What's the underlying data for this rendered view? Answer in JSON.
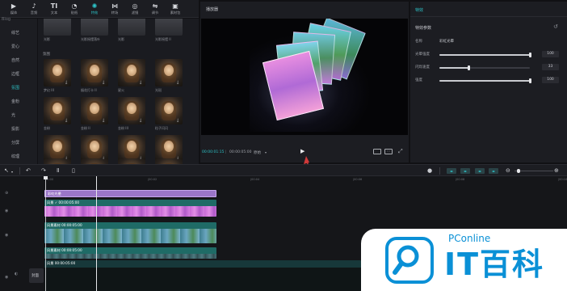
{
  "toolbar": {
    "items": [
      {
        "label": "媒体",
        "icon": "media-icon",
        "glyph": "▶"
      },
      {
        "label": "音频",
        "icon": "audio-icon",
        "glyph": "♪"
      },
      {
        "label": "文本",
        "icon": "text-icon",
        "glyph": "TI"
      },
      {
        "label": "贴纸",
        "icon": "sticker-icon",
        "glyph": "◔"
      },
      {
        "label": "特效",
        "icon": "effects-icon",
        "glyph": "✺",
        "active": true
      },
      {
        "label": "转场",
        "icon": "transition-icon",
        "glyph": "⋈"
      },
      {
        "label": "滤镜",
        "icon": "filter-icon",
        "glyph": "◎"
      },
      {
        "label": "调节",
        "icon": "adjust-icon",
        "glyph": "⇋"
      },
      {
        "label": "素材包",
        "icon": "package-icon",
        "glyph": "▣"
      }
    ]
  },
  "sidebar": {
    "top_partial": "Blog",
    "items": [
      {
        "label": "综艺"
      },
      {
        "label": "爱心"
      },
      {
        "label": "自然"
      },
      {
        "label": "边框"
      },
      {
        "label": "氛围",
        "active": true
      },
      {
        "label": "金粉"
      },
      {
        "label": "光"
      },
      {
        "label": "投影"
      },
      {
        "label": "分屏"
      },
      {
        "label": "纹理"
      }
    ]
  },
  "grid": {
    "top_labels": [
      "光影",
      "光影摇摆落叶",
      "光影",
      "光影摇摆 II"
    ],
    "section_label": "氛围",
    "row1_labels": [
      "梦幻 III",
      "烟花打卡 II",
      "星火",
      "光斑"
    ],
    "row2_labels": [
      "金粉",
      "金粉 II",
      "金粉 III",
      "粒子闪闪"
    ]
  },
  "player": {
    "title": "播放器",
    "current_time": "00:00:01:15",
    "total_time": "00:00:05:00",
    "ratio_label": "原始",
    "play_icon": "play-icon"
  },
  "props": {
    "panel_title": "特效",
    "section_title": "特效参数",
    "name_label": "名称",
    "name_value": "彩虹光晕",
    "params": [
      {
        "label": "光晕强度",
        "value": "100",
        "fraction": 1.0
      },
      {
        "label": "闪烁速度",
        "value": "33",
        "fraction": 0.33
      },
      {
        "label": "强度",
        "value": "100",
        "fraction": 1.0
      }
    ]
  },
  "timeline": {
    "ruler_ticks": [
      "00:00",
      "|00:02",
      "|00:04",
      "|00:06",
      "|00:08",
      "|00:10"
    ],
    "clips": {
      "effect": {
        "label": "彩虹光晕"
      },
      "video1": {
        "label": "风景  ✓  00:00:05:00"
      },
      "video2": {
        "label": "风景素材  00:00:05:00"
      },
      "video3": {
        "label": "风景素材  00:00:05:00"
      },
      "main": {
        "label": "风景  00:00:05:00"
      }
    },
    "cover_label": "封面"
  },
  "watermark": {
    "sub": "PConline",
    "main": "IT百科"
  },
  "colors": {
    "accent": "#2dc3c8",
    "effect_clip": "#9b76c8",
    "video_clip": "#1f6b66",
    "watermark": "#0a90d6",
    "arrow": "#d03a3a"
  }
}
